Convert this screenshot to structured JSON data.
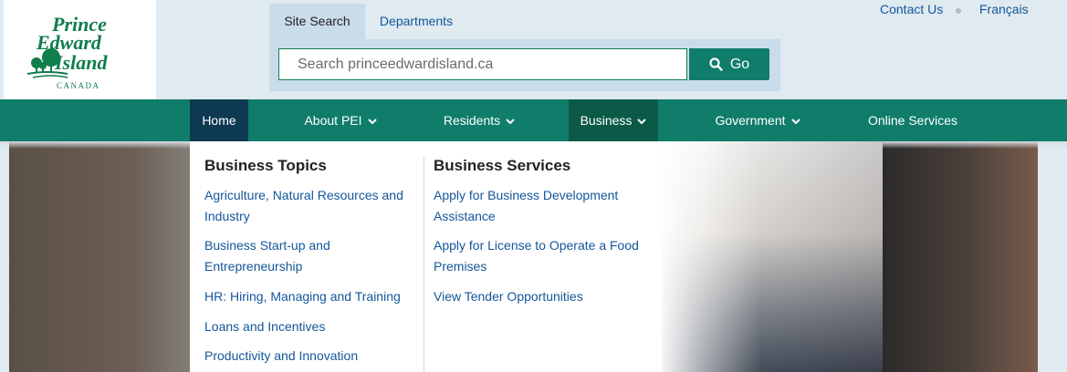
{
  "logo": {
    "line1": "Prince",
    "line2": "Edward",
    "line3": "Island",
    "country": "CANADA"
  },
  "search": {
    "tab_active": "Site Search",
    "tab_other": "Departments",
    "placeholder": "Search princeedwardisland.ca",
    "button_label": "Go"
  },
  "utility": {
    "contact": "Contact Us",
    "language": "Français"
  },
  "nav": {
    "items": [
      {
        "label": "Home",
        "has_dropdown": false
      },
      {
        "label": "About PEI",
        "has_dropdown": true
      },
      {
        "label": "Residents",
        "has_dropdown": true
      },
      {
        "label": "Business",
        "has_dropdown": true
      },
      {
        "label": "Government",
        "has_dropdown": true
      },
      {
        "label": "Online Services",
        "has_dropdown": false
      }
    ]
  },
  "dropdown": {
    "topics_heading": "Business Topics",
    "topics": [
      "Agriculture, Natural Resources and Industry",
      "Business Start-up and Entrepreneurship",
      "HR: Hiring, Managing and Training",
      "Loans and Incentives",
      "Productivity and Innovation"
    ],
    "services_heading": "Business Services",
    "services": [
      "Apply for Business Development Assistance",
      "Apply for License to Operate a Food Premises",
      "View Tender Opportunities"
    ]
  },
  "colors": {
    "nav_green": "#0f7d6a",
    "link_blue": "#13569a",
    "brand_green": "#0f7d4c"
  }
}
